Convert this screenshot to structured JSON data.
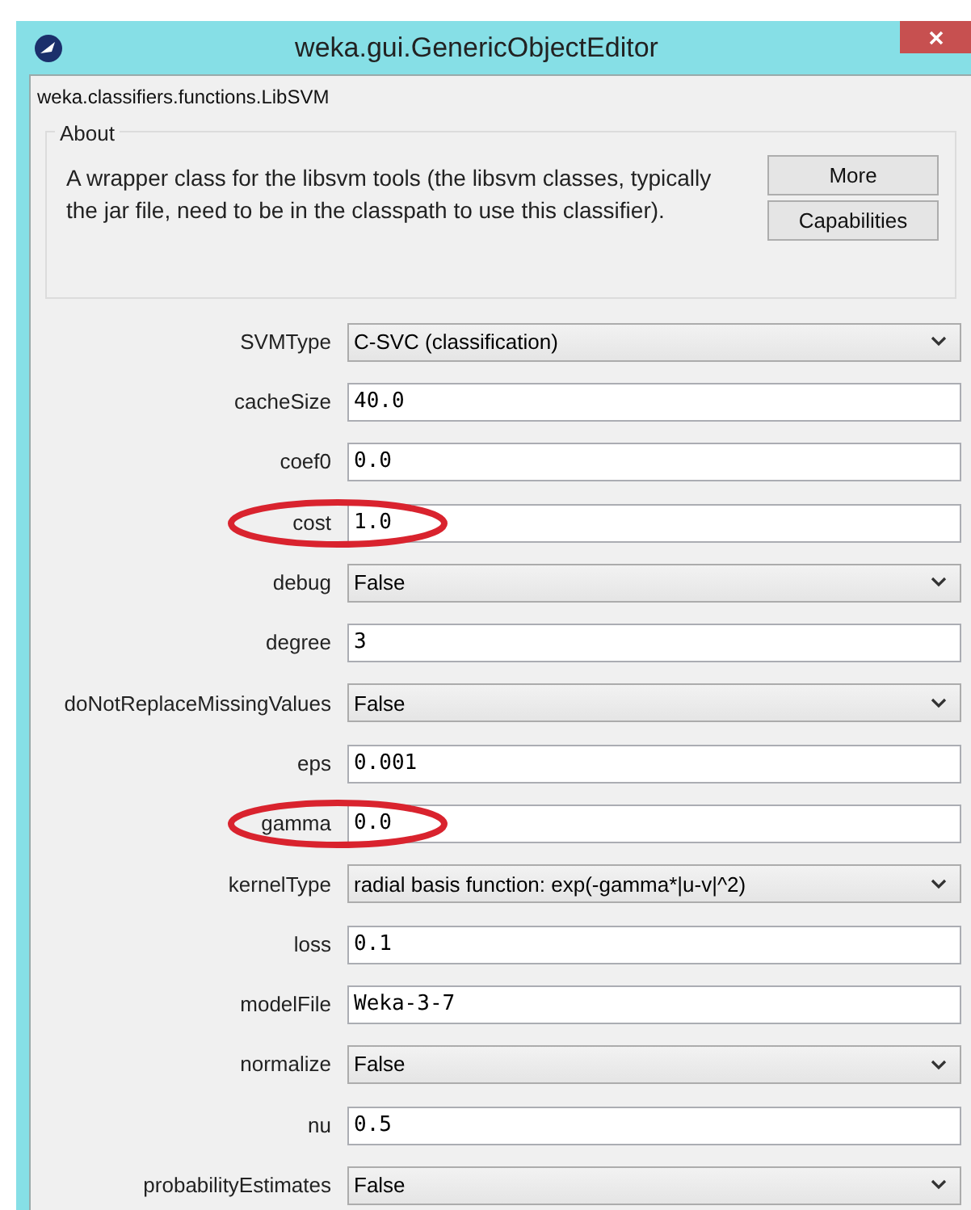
{
  "window": {
    "title": "weka.gui.GenericObjectEditor"
  },
  "class_name": "weka.classifiers.functions.LibSVM",
  "about": {
    "heading": "About",
    "description": "A wrapper class for the libsvm tools (the libsvm classes, typically the jar file, need to be in the classpath to use this classifier).",
    "buttons": [
      "More",
      "Capabilities"
    ]
  },
  "properties": [
    {
      "label": "SVMType",
      "kind": "select",
      "value": "C-SVC (classification)",
      "highlighted": false
    },
    {
      "label": "cacheSize",
      "kind": "text",
      "value": "40.0",
      "highlighted": false
    },
    {
      "label": "coef0",
      "kind": "text",
      "value": "0.0",
      "highlighted": false
    },
    {
      "label": "cost",
      "kind": "text",
      "value": "1.0",
      "highlighted": true
    },
    {
      "label": "debug",
      "kind": "select",
      "value": "False",
      "highlighted": false
    },
    {
      "label": "degree",
      "kind": "text",
      "value": "3",
      "highlighted": false
    },
    {
      "label": "doNotReplaceMissingValues",
      "kind": "select",
      "value": "False",
      "highlighted": false
    },
    {
      "label": "eps",
      "kind": "text",
      "value": "0.001",
      "highlighted": false
    },
    {
      "label": "gamma",
      "kind": "text",
      "value": "0.0",
      "highlighted": true
    },
    {
      "label": "kernelType",
      "kind": "select",
      "value": "radial basis function: exp(-gamma*|u-v|^2)",
      "highlighted": false
    },
    {
      "label": "loss",
      "kind": "text",
      "value": "0.1",
      "highlighted": false
    },
    {
      "label": "modelFile",
      "kind": "text",
      "value": "Weka-3-7",
      "highlighted": false
    },
    {
      "label": "normalize",
      "kind": "select",
      "value": "False",
      "highlighted": false
    },
    {
      "label": "nu",
      "kind": "text",
      "value": "0.5",
      "highlighted": false
    },
    {
      "label": "probabilityEstimates",
      "kind": "select",
      "value": "False",
      "highlighted": false
    }
  ]
}
